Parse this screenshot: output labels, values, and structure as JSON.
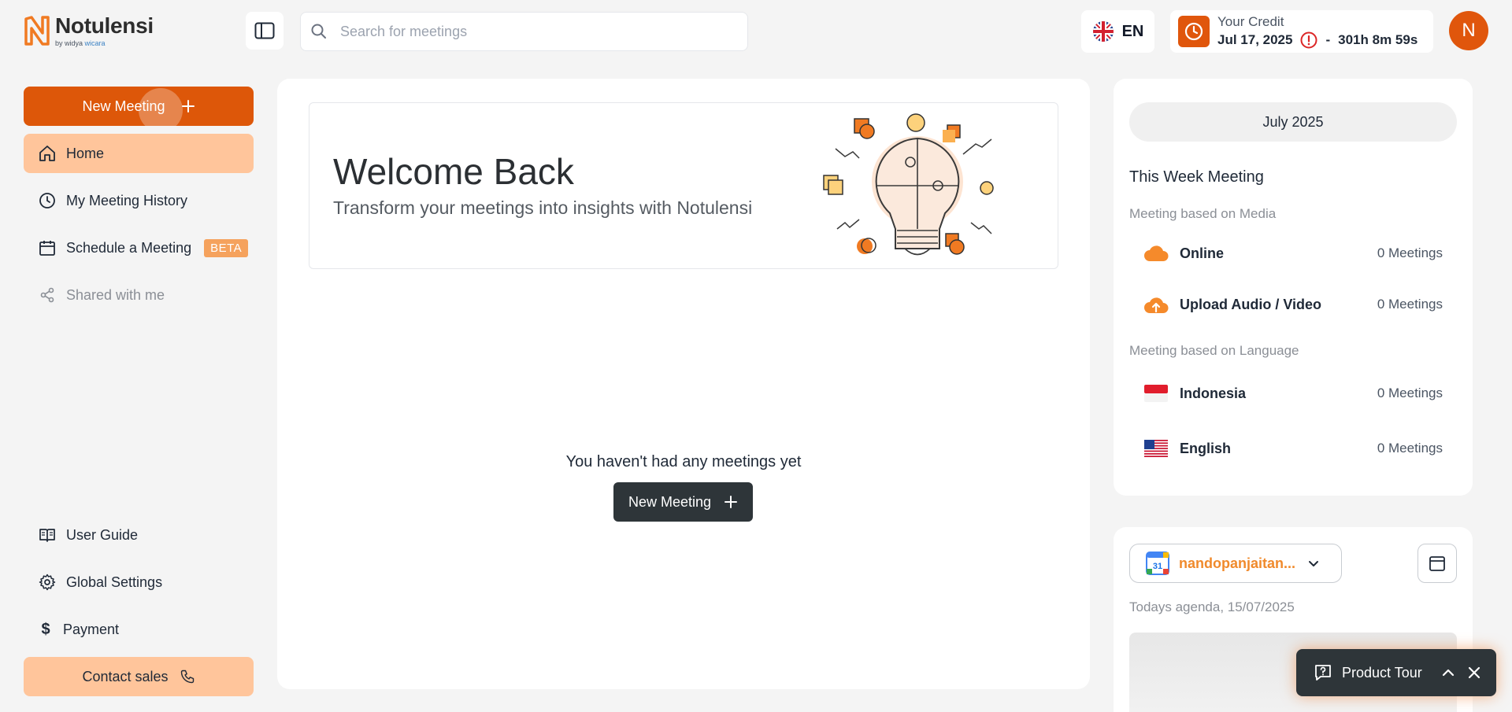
{
  "app": {
    "name": "Notulensi",
    "sub_prefix": "by widya",
    "sub_brand": "wicara"
  },
  "header": {
    "search_placeholder": "Search for meetings",
    "language": "EN",
    "credit_label": "Your Credit",
    "credit_date": "Jul 17, 2025",
    "credit_sep": "-",
    "credit_remaining": "301h 8m 59s",
    "avatar_initial": "N"
  },
  "sidebar": {
    "new_meeting": "New Meeting",
    "items": [
      {
        "label": "Home"
      },
      {
        "label": "My Meeting History"
      },
      {
        "label": "Schedule a Meeting",
        "badge": "BETA"
      },
      {
        "label": "Shared with me"
      }
    ],
    "bottom": [
      {
        "label": "User Guide"
      },
      {
        "label": "Global Settings"
      },
      {
        "label": "Payment"
      }
    ],
    "contact_sales": "Contact sales"
  },
  "main": {
    "welcome_title": "Welcome Back",
    "welcome_subtitle": "Transform your meetings into insights with Notulensi",
    "empty_text": "You haven't had any meetings yet",
    "new_meeting": "New Meeting"
  },
  "right_panel": {
    "month": "July 2025",
    "title": "This Week Meeting",
    "media_heading": "Meeting based on Media",
    "media": [
      {
        "name": "Online",
        "count": "0 Meetings"
      },
      {
        "name": "Upload Audio / Video",
        "count": "0 Meetings"
      }
    ],
    "language_heading": "Meeting based on Language",
    "languages": [
      {
        "name": "Indonesia",
        "count": "0 Meetings"
      },
      {
        "name": "English",
        "count": "0 Meetings"
      }
    ],
    "calendar_account": "nandopanjaitan...",
    "calendar_day": "31",
    "agenda_label": "Todays agenda, 15/07/2025"
  },
  "tour": {
    "label": "Product Tour"
  },
  "colors": {
    "brand_orange": "#dd5709",
    "active_bg": "#ffc59b",
    "dark_button": "#2e3539"
  }
}
